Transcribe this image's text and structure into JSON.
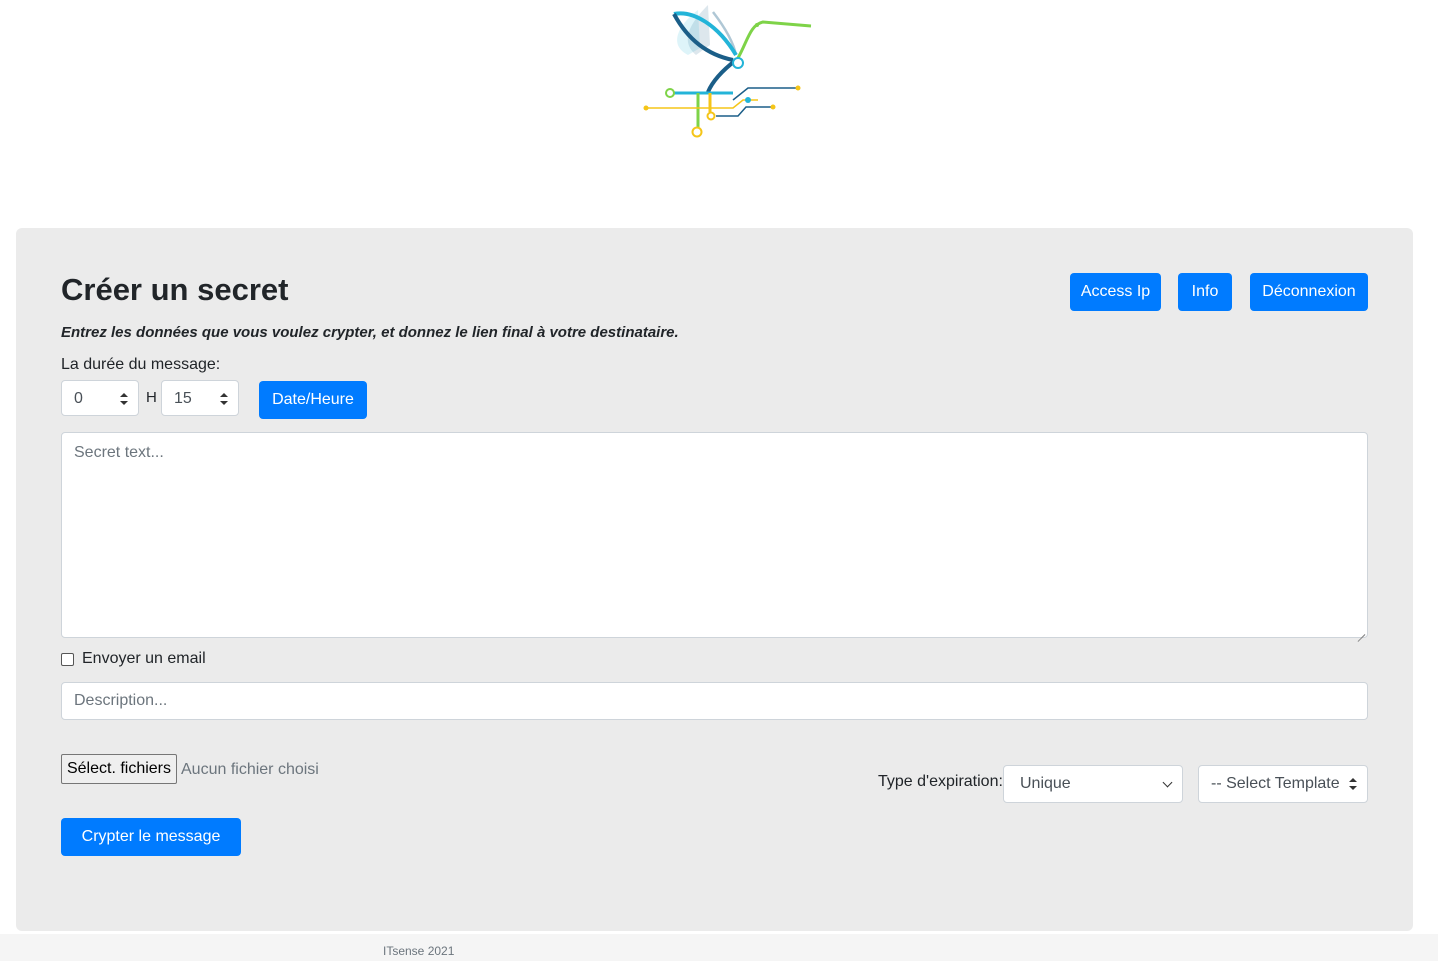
{
  "logo": {
    "alt": "hummingbird-circuit-logo",
    "colors": [
      "#1b5e88",
      "#23b4d8",
      "#7ed348",
      "#f5c518"
    ]
  },
  "form": {
    "title": "Créer un secret",
    "subtitle": "Entrez les données que vous voulez crypter, et donnez le lien final à votre destinataire.",
    "duration_label": "La durée du message:",
    "hours_value": "0",
    "h_label": "H",
    "minutes_value": "15",
    "datetime_button": "Date/Heure",
    "secret_placeholder": "Secret text...",
    "email_checkbox_label": "Envoyer un email",
    "email_checked": false,
    "description_placeholder": "Description...",
    "file_button": "Sélect. fichiers",
    "file_status": "Aucun fichier choisi",
    "expiration_label": "Type d'expiration:",
    "expiration_value": "Unique",
    "template_value": "-- Select Template",
    "submit_button": "Crypter le message"
  },
  "header_buttons": {
    "access_ip": "Access Ip",
    "info": "Info",
    "logout": "Déconnexion"
  },
  "colors": {
    "primary": "#007bff",
    "card_bg": "#ebebeb"
  },
  "footer": {
    "text": "ITsense 2021"
  }
}
